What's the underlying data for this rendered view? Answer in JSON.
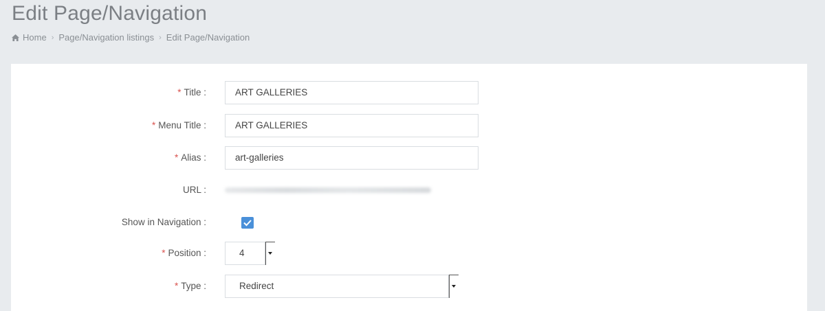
{
  "page": {
    "title": "Edit Page/Navigation"
  },
  "breadcrumb": {
    "home": "Home",
    "listings": "Page/Navigation listings",
    "current": "Edit Page/Navigation"
  },
  "form": {
    "required_mark": "*",
    "title": {
      "label": "Title :",
      "value": "ART GALLERIES"
    },
    "menu_title": {
      "label": "Menu Title :",
      "value": "ART GALLERIES"
    },
    "alias": {
      "label": "Alias :",
      "value": "art-galleries"
    },
    "url": {
      "label": "URL :"
    },
    "show_in_navigation": {
      "label": "Show in Navigation :",
      "checked": true
    },
    "position": {
      "label": "Position :",
      "value": "4"
    },
    "type": {
      "label": "Type :",
      "value": "Redirect"
    }
  },
  "colors": {
    "accent": "#4a90d9",
    "required": "#d9534f"
  }
}
